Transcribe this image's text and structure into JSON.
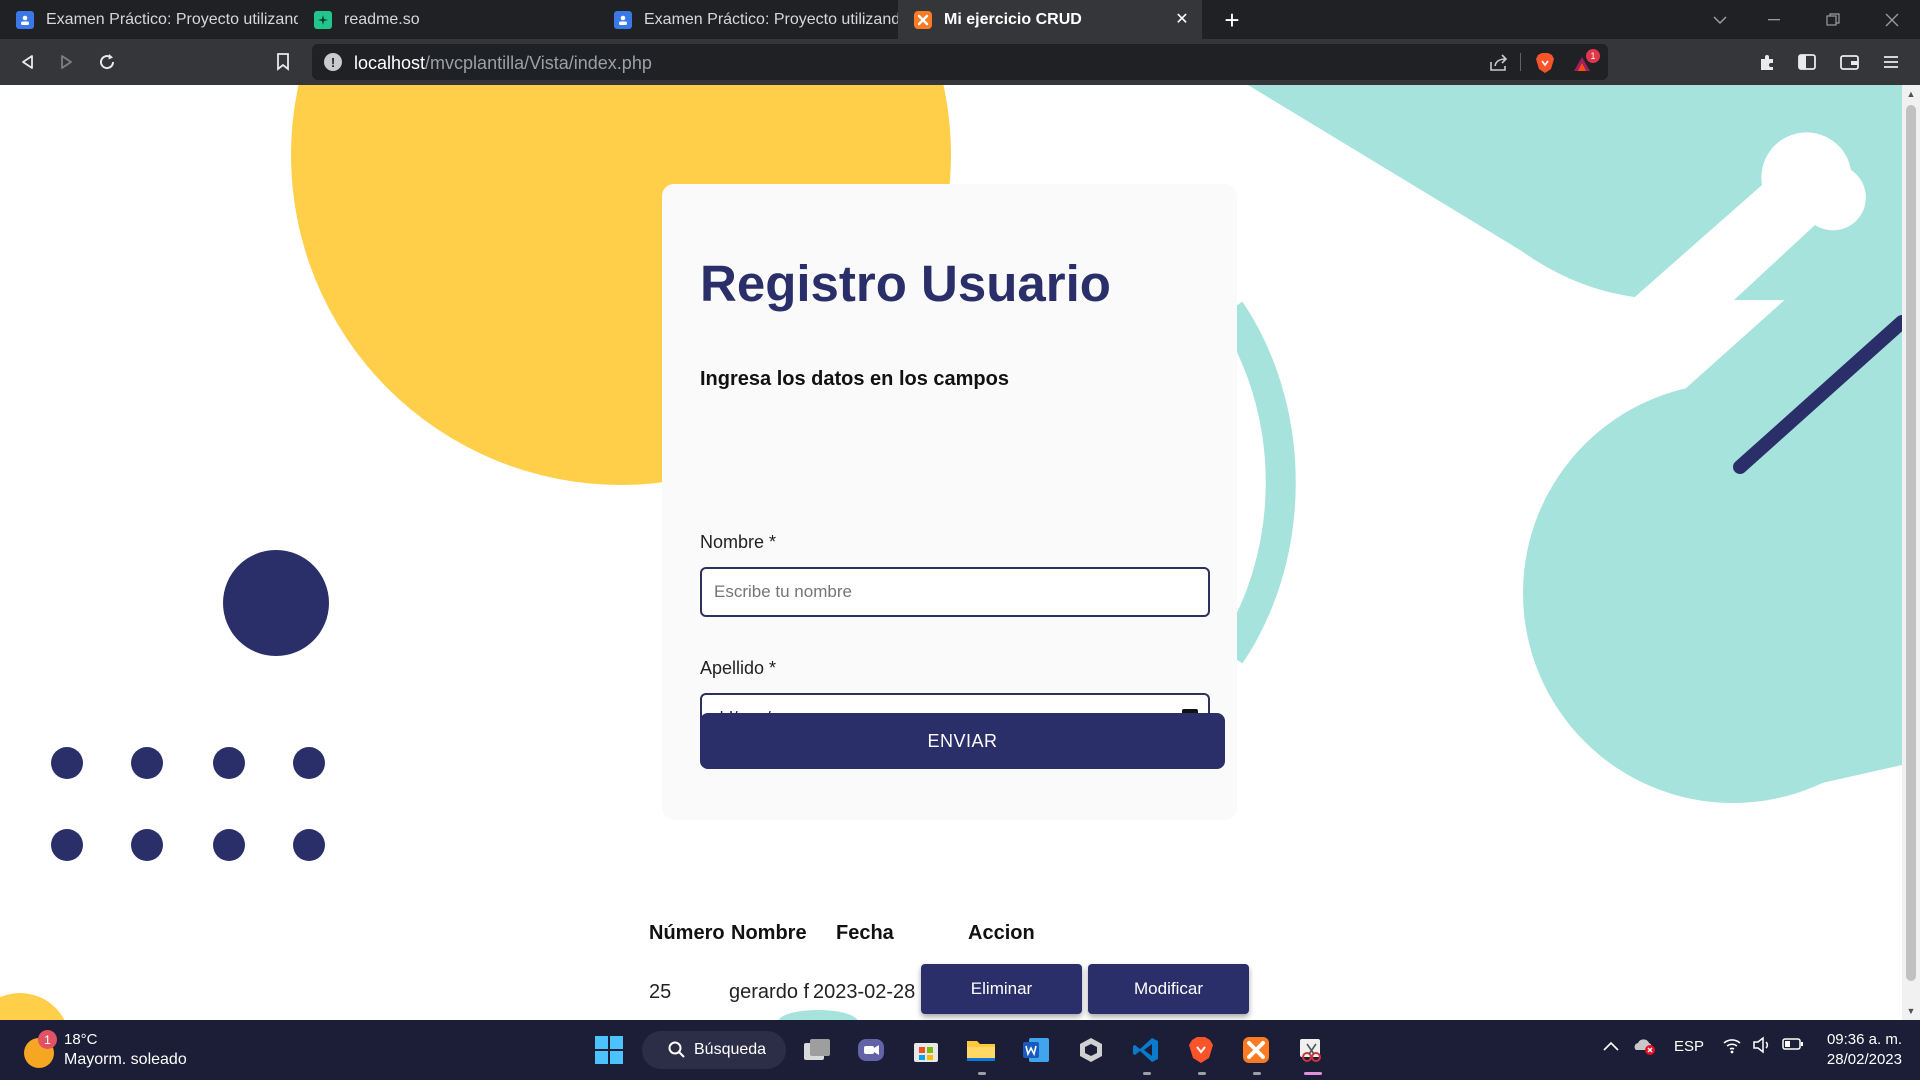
{
  "browser": {
    "tabs": [
      {
        "title": "Examen Práctico: Proyecto utilizando e",
        "icon": "classroom-icon",
        "active": false
      },
      {
        "title": "readme.so",
        "icon": "readme-icon",
        "active": false
      },
      {
        "title": "Examen Práctico: Proyecto utilizando e",
        "icon": "classroom-icon",
        "active": false
      },
      {
        "title": "Mi ejercicio CRUD",
        "icon": "xampp-icon",
        "active": true
      }
    ],
    "new_tab_label": "+",
    "url_host": "localhost",
    "url_path": "/mvcplantilla/Vista/index.php",
    "brave_badge_count": "1"
  },
  "page": {
    "title": "Registro Usuario",
    "subtitle": "Ingresa los datos en los campos",
    "fields": {
      "nombre": {
        "label": "Nombre *",
        "placeholder": "Escribe tu nombre"
      },
      "apellido": {
        "label": "Apellido *",
        "value": "dd/mm/aaaa"
      }
    },
    "submit_label": "ENVIAR",
    "table": {
      "headers": [
        "Número",
        "Nombre",
        "Fecha",
        "Accion"
      ],
      "rows": [
        {
          "numero": "25",
          "nombre": "gerardo f",
          "fecha": "2023-02-28"
        }
      ],
      "delete_label": "Eliminar",
      "modify_label": "Modificar"
    }
  },
  "taskbar": {
    "weather": {
      "badge": "1",
      "temp": "18°C",
      "condition": "Mayorm. soleado"
    },
    "search_label": "Búsqueda",
    "language": "ESP",
    "time": "09:36 a. m.",
    "date": "28/02/2023"
  },
  "colors": {
    "accent": "#2b2f69",
    "mint": "#a6e3dc",
    "yellow": "#ffcf4a",
    "chrome_dark": "#202124",
    "chrome_toolbar": "#35363a",
    "taskbar": "#1c1d36"
  }
}
